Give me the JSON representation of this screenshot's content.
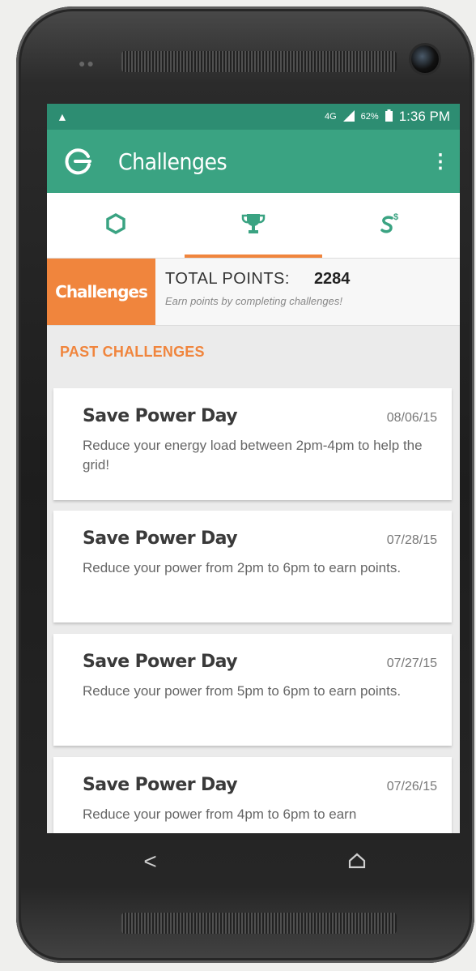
{
  "status_bar": {
    "alert_icon": "warning-icon",
    "network_label": "4G",
    "battery_percent": "62%",
    "time": "1:36 PM"
  },
  "app_bar": {
    "title": "Challenges",
    "back_icon": "refresh-back-icon",
    "menu_icon": "more-vertical-icon"
  },
  "tabs": [
    {
      "icon": "hexagon-icon",
      "active": false
    },
    {
      "icon": "trophy-icon",
      "active": true
    },
    {
      "icon": "savings-icon",
      "active": false
    }
  ],
  "points": {
    "badge_label": "Challenges",
    "total_label": "TOTAL POINTS:",
    "total_value": "2284",
    "subtitle": "Earn points by completing challenges!"
  },
  "section_title": "PAST CHALLENGES",
  "challenges": [
    {
      "title": "Save Power Day",
      "date": "08/06/15",
      "description": "Reduce your energy load between 2pm-4pm to help the grid!"
    },
    {
      "title": "Save Power Day",
      "date": "07/28/15",
      "description": "Reduce your power from 2pm to 6pm to earn points."
    },
    {
      "title": "Save Power Day",
      "date": "07/27/15",
      "description": "Reduce your power from 5pm to 6pm to earn points."
    },
    {
      "title": "Save Power Day",
      "date": "07/26/15",
      "description": "Reduce your power from 4pm to 6pm to earn"
    }
  ],
  "colors": {
    "primary": "#3aa382",
    "status_bar": "#2d8d72",
    "accent": "#f0853d"
  }
}
